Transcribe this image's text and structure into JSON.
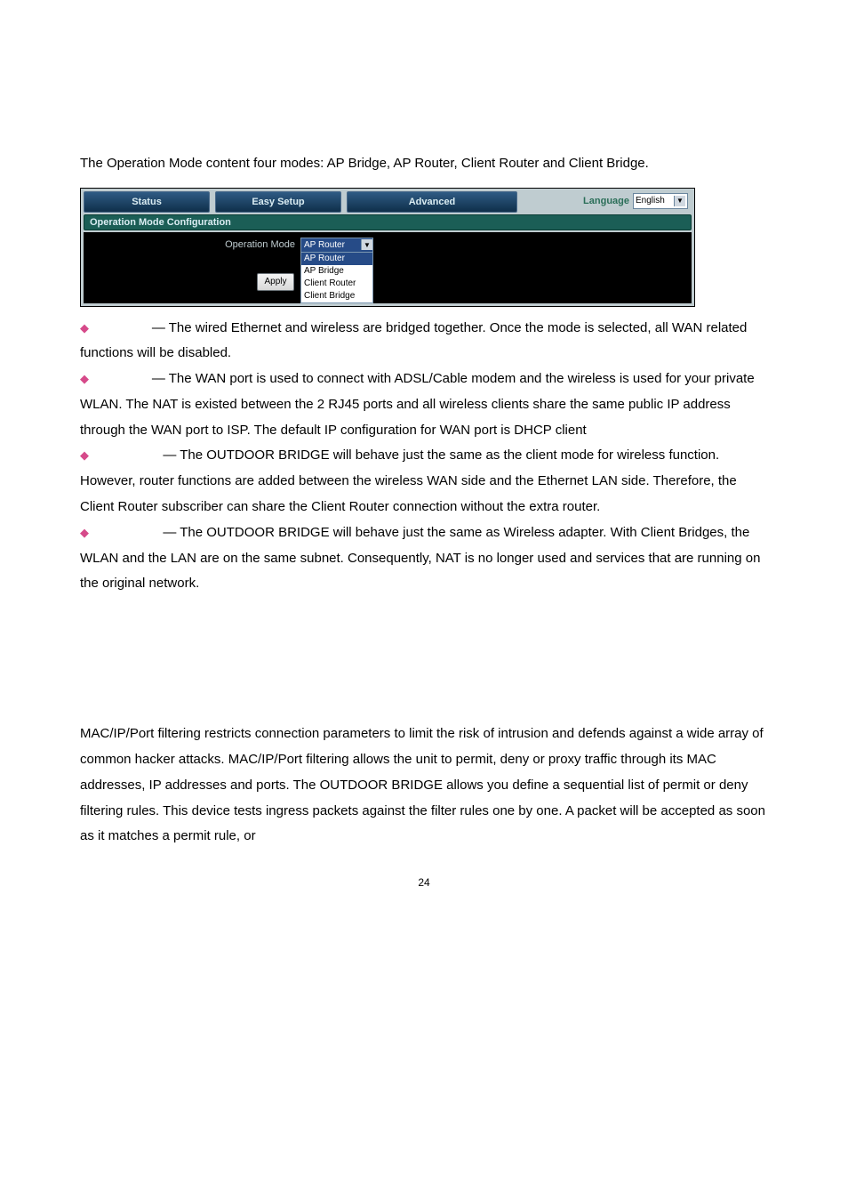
{
  "intro": "The Operation Mode content four modes: AP Bridge, AP Router, Client Router and Client Bridge.",
  "ui": {
    "tabs": {
      "status": "Status",
      "easy": "Easy Setup",
      "advanced": "Advanced"
    },
    "language_label": "Language",
    "language_value": "English",
    "section_title": "Operation Mode Configuration",
    "op_mode_label": "Operation Mode",
    "selected": "AP Router",
    "options": [
      "AP Router",
      "AP Bridge",
      "Client Router",
      "Client Bridge"
    ],
    "apply": "Apply"
  },
  "bullets": [
    {
      "lead": " — The wired Ethernet and wireless are bridged together. Once the mode is selected, all WAN related functions will be disabled."
    },
    {
      "lead": " — The WAN port is used to connect with ADSL/Cable modem and the wireless is used for your private WLAN. The NAT is existed between the 2 RJ45 ports and all wireless clients share the same public IP address through the WAN port to ISP. The default IP configuration for WAN port is DHCP client"
    },
    {
      "lead": " — The OUTDOOR BRIDGE will behave just the same as the client mode for wireless function. However, router functions are added between the wireless WAN side and the Ethernet LAN side. Therefore, the Client Router subscriber can share the Client Router connection without the extra router."
    },
    {
      "lead": " — The OUTDOOR BRIDGE will behave just the same as Wireless adapter. With Client Bridges, the WLAN and the LAN are on the same subnet. Consequently, NAT is no longer used and services that are running on the original network."
    }
  ],
  "lower": "MAC/IP/Port filtering restricts connection parameters to limit the risk of intrusion and defends against a wide array of common hacker attacks. MAC/IP/Port filtering allows the unit to permit, deny or proxy traffic through its MAC addresses, IP addresses and ports. The OUTDOOR BRIDGE allows you define a sequential list of permit or deny filtering rules. This device tests ingress packets against the filter rules one by one. A packet will be accepted as soon as it matches a permit rule, or",
  "page_num": "24"
}
